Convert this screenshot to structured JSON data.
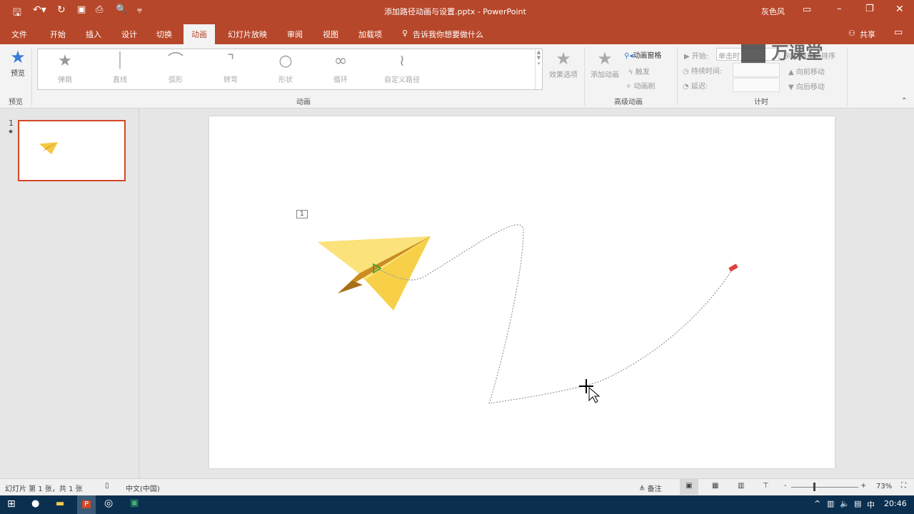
{
  "window": {
    "title": "添加路径动画与设置.pptx - PowerPoint",
    "user": "灰色风"
  },
  "tabs": [
    "文件",
    "开始",
    "插入",
    "设计",
    "切换",
    "动画",
    "幻灯片放映",
    "审阅",
    "视图",
    "加载项"
  ],
  "tell_me": "告诉我你想要做什么",
  "share": "共享",
  "ribbon": {
    "preview": "预览",
    "preview_group": "预览",
    "gallery": [
      "弹跳",
      "直线",
      "弧形",
      "转弯",
      "形状",
      "循环",
      "自定义路径"
    ],
    "gallery_group": "动画",
    "effect_options": "效果选项",
    "add_animation": "添加动画",
    "animation_pane": "动画窗格",
    "trigger": "触发",
    "animation_painter": "动画刷",
    "advanced_group": "高级动画",
    "start_label": "开始:",
    "start_value": "单击时",
    "duration_label": "持续时间:",
    "delay_label": "延迟:",
    "reorder_label": "对动画重新排序",
    "move_earlier": "向前移动",
    "move_later": "向后移动",
    "timing_group": "计时"
  },
  "watermark": "万课堂",
  "slides": [
    {
      "number": "1",
      "has_animation": "★"
    }
  ],
  "slide": {
    "animation_tag": "1"
  },
  "status": {
    "slide_info": "幻灯片 第 1 张，共 1 张",
    "language": "中文(中国)",
    "notes": "备注",
    "zoom": "73%",
    "zoom_percent": 73
  },
  "taskbar": {
    "time": "20:46",
    "ime": "中"
  },
  "colors": {
    "accent": "#b7472a",
    "taskbar": "#0b2f4e",
    "path_start": "#2ca02c",
    "path_end": "#e04040"
  }
}
